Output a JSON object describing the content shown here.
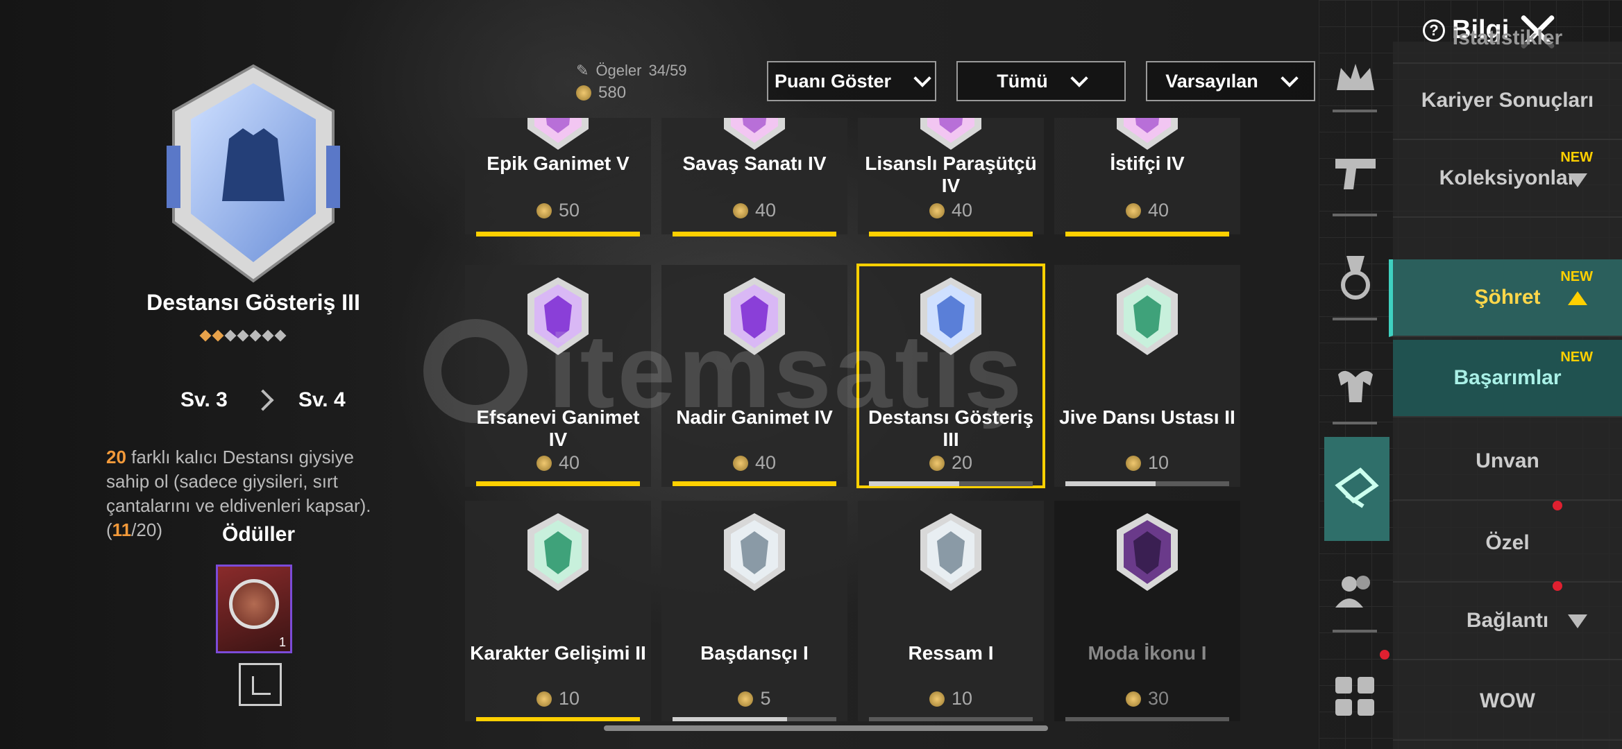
{
  "header": {
    "info_label": "Bilgi",
    "items_label": "Ögeler",
    "items_count": "34/59",
    "points": "580",
    "dropdowns": [
      "Puanı Göster",
      "Tümü",
      "Varsayılan"
    ]
  },
  "selected": {
    "title": "Destansı Gösteriş III",
    "stars_filled": 2,
    "stars_total": 7,
    "level_from": "Sv. 3",
    "level_to": "Sv. 4",
    "desc_num": "20",
    "desc_text": " farklı kalıcı Destansı giysiye sahip ol (sadece giysileri, sırt çantalarını ve eldivenleri kapsar). (",
    "desc_progress": "11",
    "desc_total": "/20)",
    "rewards_title": "Ödüller",
    "reward_count": "1"
  },
  "cards": [
    {
      "name": "Epik Ganimet V",
      "points": "50",
      "progress": 1.0,
      "color": "#ffd000",
      "tier": "pink"
    },
    {
      "name": "Savaş Sanatı IV",
      "points": "40",
      "progress": 1.0,
      "color": "#ffd000",
      "tier": "pink"
    },
    {
      "name": "Lisanslı Paraşütçü IV",
      "points": "40",
      "progress": 1.0,
      "color": "#ffd000",
      "tier": "pink"
    },
    {
      "name": "İstifçi IV",
      "points": "40",
      "progress": 1.0,
      "color": "#ffd000",
      "tier": "pink"
    },
    {
      "name": "Efsanevi Ganimet IV",
      "points": "40",
      "progress": 1.0,
      "color": "#ffd000",
      "tier": "purple"
    },
    {
      "name": "Nadir Ganimet IV",
      "points": "40",
      "progress": 1.0,
      "color": "#ffd000",
      "tier": "purple"
    },
    {
      "name": "Destansı Gösteriş III",
      "points": "20",
      "progress": 0.55,
      "color": "#cfcfcf",
      "tier": "blue",
      "selected": true
    },
    {
      "name": "Jive Dansı Ustası II",
      "points": "10",
      "progress": 0.55,
      "color": "#cfcfcf",
      "tier": "green"
    },
    {
      "name": "Karakter Gelişimi II",
      "points": "10",
      "progress": 1.0,
      "color": "#ffd000",
      "tier": "green"
    },
    {
      "name": "Başdansçı I",
      "points": "5",
      "progress": 0.7,
      "color": "#cfcfcf",
      "tier": "silver"
    },
    {
      "name": "Ressam I",
      "points": "10",
      "progress": 0.0,
      "color": "#cfcfcf",
      "tier": "silver"
    },
    {
      "name": "Moda İkonu I",
      "points": "30",
      "progress": 0.0,
      "color": "#cfcfcf",
      "tier": "locked",
      "dim": true
    }
  ],
  "menu": {
    "items": [
      {
        "label": "İstatistikler"
      },
      {
        "label": "Kariyer Sonuçları"
      },
      {
        "label": "Koleksiyonlar",
        "new": "NEW"
      },
      {
        "label": "Şöhret",
        "new": "NEW"
      },
      {
        "label": "Başarımlar",
        "new": "NEW"
      },
      {
        "label": "Unvan"
      },
      {
        "label": "Özel"
      },
      {
        "label": "Bağlantı"
      },
      {
        "label": "WOW"
      }
    ]
  },
  "watermark": "itemsatış"
}
